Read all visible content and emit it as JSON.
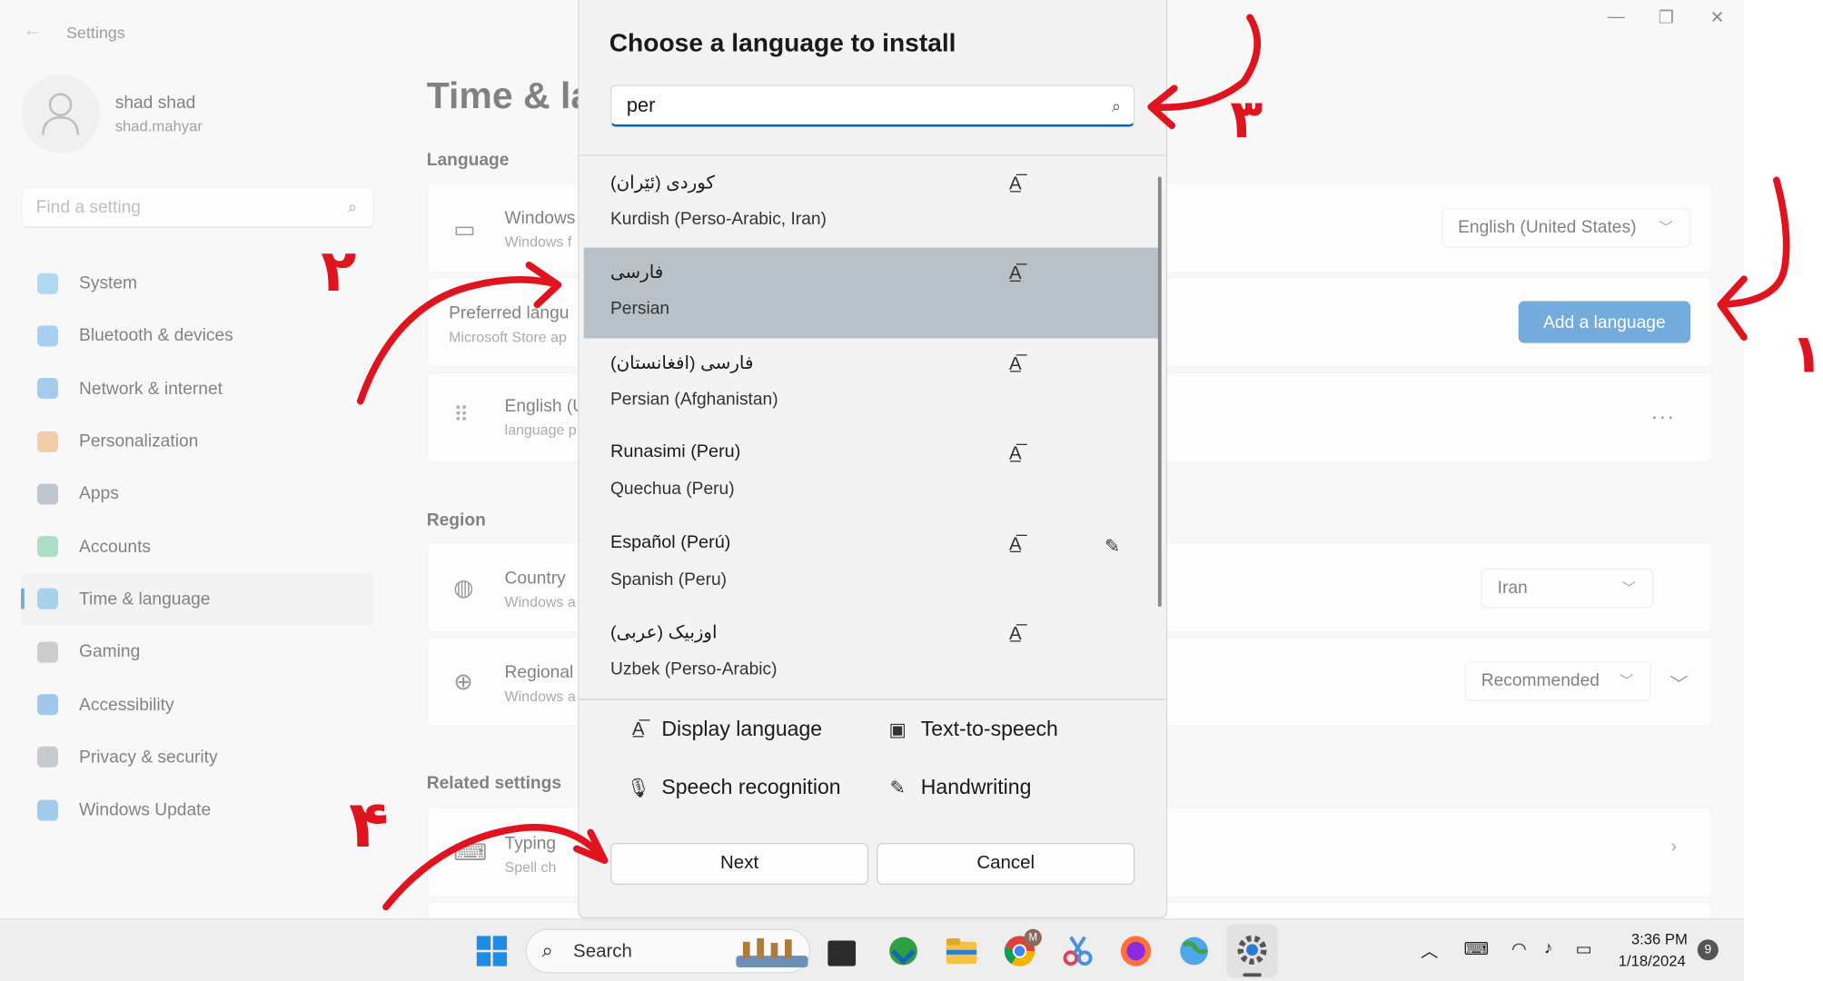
{
  "window": {
    "title": "Settings",
    "controls": {
      "minimize": "—",
      "maximize": "❐",
      "close": "✕"
    }
  },
  "user": {
    "name": "shad shad",
    "email": "shad.mahyar"
  },
  "search": {
    "placeholder": "Find a setting"
  },
  "sidebar": {
    "items": [
      {
        "label": "System",
        "color": "#4aa3df"
      },
      {
        "label": "Bluetooth & devices",
        "color": "#2f8fe0"
      },
      {
        "label": "Network & internet",
        "color": "#2b88d8"
      },
      {
        "label": "Personalization",
        "color": "#e08a3a"
      },
      {
        "label": "Apps",
        "color": "#6b7a8f"
      },
      {
        "label": "Accounts",
        "color": "#3bb27a"
      },
      {
        "label": "Time & language",
        "color": "#2f9ad6"
      },
      {
        "label": "Gaming",
        "color": "#8a8a8a"
      },
      {
        "label": "Accessibility",
        "color": "#1f7fd1"
      },
      {
        "label": "Privacy & security",
        "color": "#7a8592"
      },
      {
        "label": "Windows Update",
        "color": "#1a88d8"
      }
    ],
    "active_index": 6
  },
  "main": {
    "page_title": "Time & la",
    "language_section": "Language",
    "windows_display": {
      "title": "Windows",
      "sub": "Windows f",
      "value": "English (United States)"
    },
    "preferred": {
      "title": "Preferred langu",
      "sub": "Microsoft Store ap",
      "button": "Add a language"
    },
    "english_row": {
      "title": "English (U",
      "sub": "language p",
      "more": "···"
    },
    "region_section": "Region",
    "country": {
      "title": "Country",
      "sub": "Windows a",
      "value": "Iran"
    },
    "regional": {
      "title": "Regional",
      "sub": "Windows a",
      "value": "Recommended"
    },
    "related_section": "Related settings",
    "typing": {
      "title": "Typing",
      "sub": "Spell ch"
    }
  },
  "dialog": {
    "title": "Choose a language to install",
    "search_value": "per",
    "languages": [
      {
        "native": "کوردی (ئێران)",
        "english": "Kurdish (Perso-Arabic, Iran)",
        "display": true,
        "handwriting": false
      },
      {
        "native": "فارسی",
        "english": "Persian",
        "display": true,
        "handwriting": false,
        "selected": true
      },
      {
        "native": "فارسی (افغانستان)",
        "english": "Persian (Afghanistan)",
        "display": true,
        "handwriting": false
      },
      {
        "native": "Runasimi (Peru)",
        "english": "Quechua (Peru)",
        "display": true,
        "handwriting": false
      },
      {
        "native": "Español (Perú)",
        "english": "Spanish (Peru)",
        "display": true,
        "handwriting": true
      },
      {
        "native": "اوزبیک (عربی)",
        "english": "Uzbek (Perso-Arabic)",
        "display": true,
        "handwriting": false
      }
    ],
    "legend": {
      "display_language": "Display language",
      "text_to_speech": "Text-to-speech",
      "speech_recognition": "Speech recognition",
      "handwriting": "Handwriting"
    },
    "next_label": "Next",
    "cancel_label": "Cancel"
  },
  "taskbar": {
    "search_label": "Search",
    "time": "3:36 PM",
    "date": "1/18/2024",
    "notification_count": "9",
    "chrome_badge": "M"
  },
  "annotations": {
    "step1": "۱",
    "step2": "۲",
    "step3": "۳",
    "step4": "۴"
  },
  "colors": {
    "accent": "#0067c0",
    "selected_row": "#b8c1c8",
    "annotation_red": "#e0141e"
  }
}
